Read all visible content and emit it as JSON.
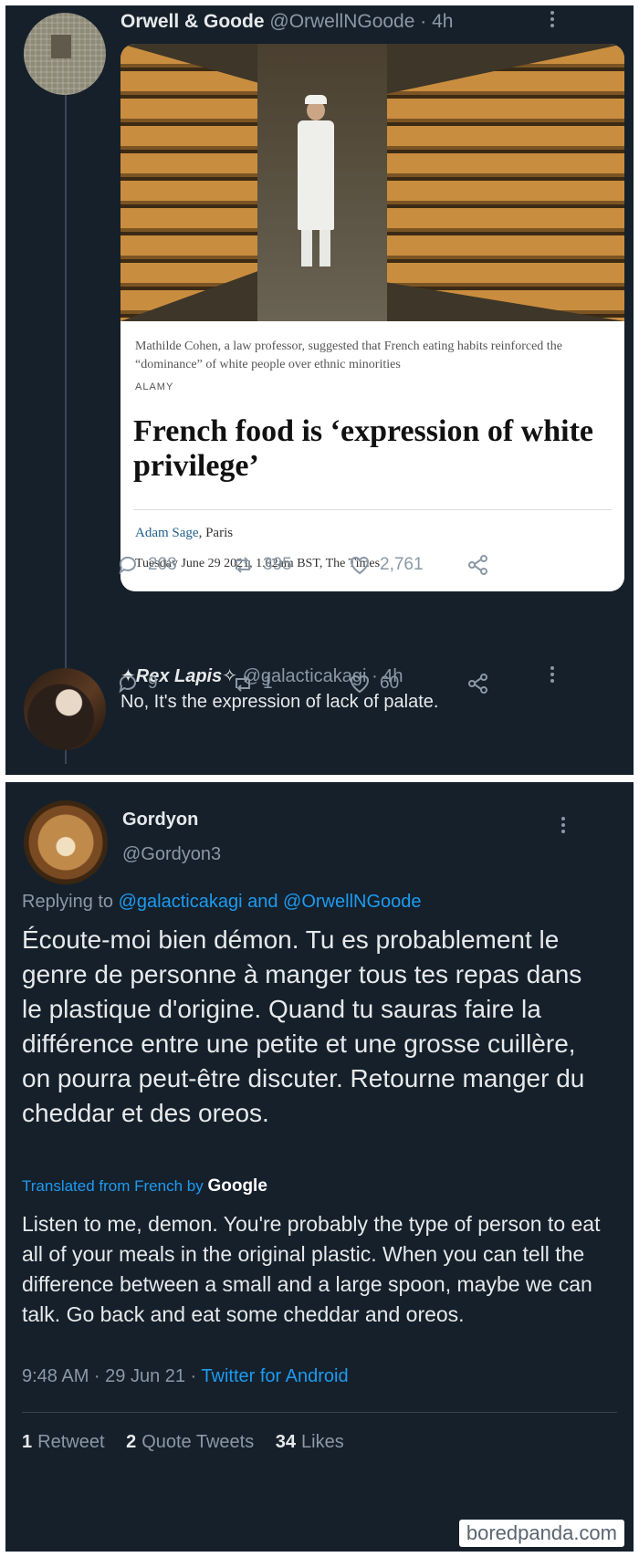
{
  "tweet1": {
    "name": "Orwell & Goode",
    "handle": "@OrwellNGoode",
    "time": "· 4h",
    "article": {
      "caption": "Mathilde Cohen, a law professor, suggested that French eating habits reinforced the “dominance” of white people over ethnic minorities",
      "credit": "ALAMY",
      "headline": "French food is ‘expression of white privilege’",
      "author": "Adam Sage",
      "location": ", Paris",
      "date": "Tuesday June 29 2021, 1.02am BST, The Times"
    },
    "stats": {
      "replies": "208",
      "retweets": "395",
      "likes": "2,761"
    }
  },
  "reply1": {
    "name": "✦Rex Lapis✧",
    "handle": "@galacticakagi",
    "time": "· 4h",
    "text": "No, It's the expression of lack of palate.",
    "stats": {
      "replies": "9",
      "retweets": "1",
      "likes": "60"
    }
  },
  "tweet2": {
    "name": "Gordyon",
    "handle": "@Gordyon3",
    "replying_prefix": "Replying to ",
    "replying_to": "@galacticakagi and @OrwellNGoode",
    "text_fr": "Écoute-moi bien démon. Tu es probablement le genre de personne à manger tous tes repas dans le plastique d'origine. Quand tu sauras faire la différence entre une petite et une grosse cuillère, on pourra peut-être discuter. Retourne manger du cheddar et des oreos.",
    "translated_label": "Translated from French by ",
    "translator": "Google",
    "text_en": "Listen to me, demon. You're probably the type of person to eat all of your meals in the original plastic. When you can tell the difference between a small and a large spoon, maybe we can talk. Go back and eat some cheddar and oreos.",
    "timestamp": "9:48 AM · 29 Jun 21 · ",
    "source": "Twitter for Android",
    "retweets_count": "1",
    "retweets_label": "Retweet",
    "quotes_count": "2",
    "quotes_label": "Quote Tweets",
    "likes_count": "34",
    "likes_label": "Likes"
  },
  "watermark": "boredpanda.com",
  "icons": [
    "more-icon",
    "reply-icon",
    "retweet-icon",
    "like-icon",
    "share-icon"
  ],
  "colors": {
    "background": "#15202b",
    "accent": "#1d9bf0",
    "muted": "#8b98a5"
  }
}
